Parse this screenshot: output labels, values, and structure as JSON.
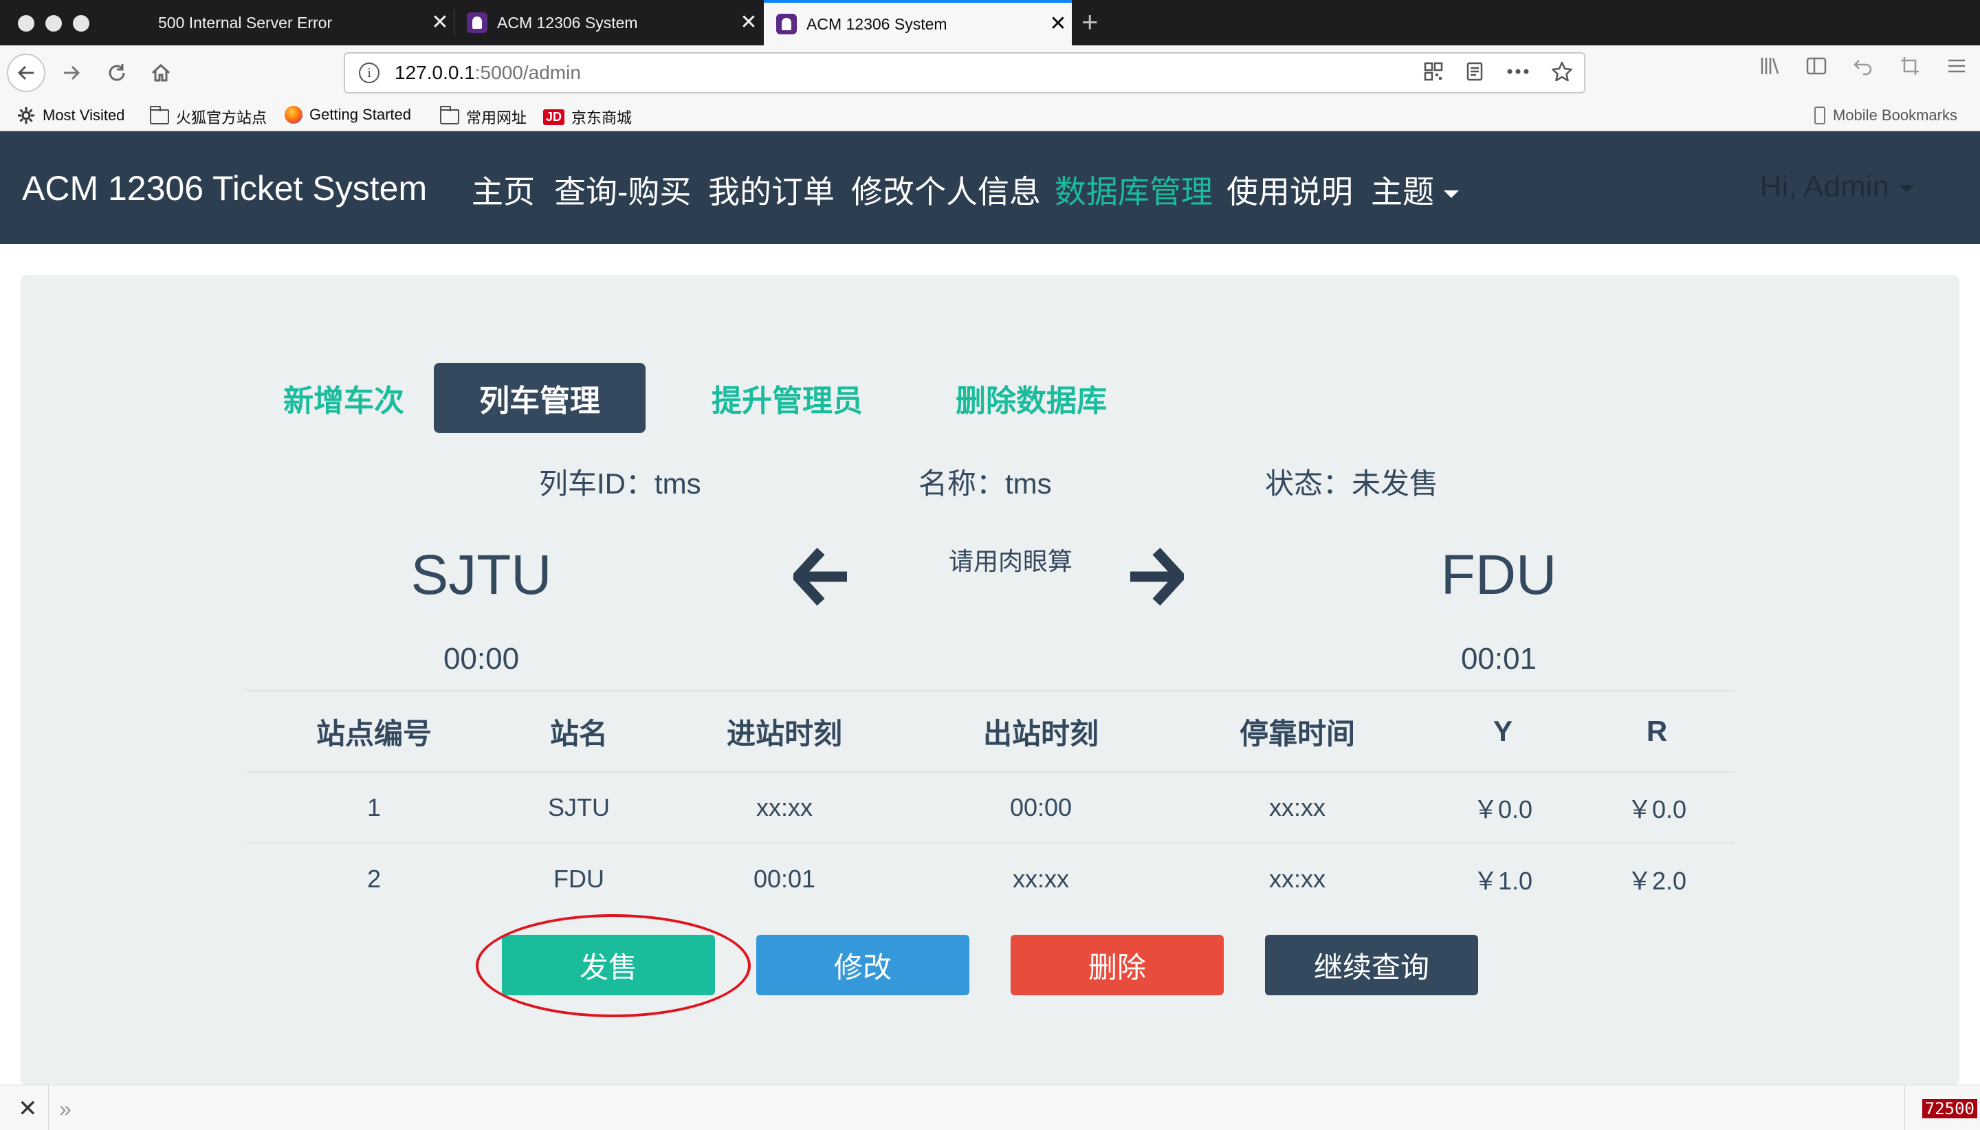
{
  "browser": {
    "tabs": [
      {
        "title": "500 Internal Server Error",
        "active": false
      },
      {
        "title": "ACM 12306 System",
        "active": false
      },
      {
        "title": "ACM 12306 System",
        "active": true
      }
    ],
    "url_host": "127.0.0.1",
    "url_path": ":5000/admin",
    "bookmarks": [
      "Most Visited",
      "火狐官方站点",
      "Getting Started",
      "常用网址",
      "京东商城"
    ],
    "mobile_bookmarks": "Mobile Bookmarks",
    "jd_logo": "JD",
    "status_badge": "72500"
  },
  "app": {
    "brand": "ACM 12306 Ticket System",
    "nav": [
      "主页",
      "查询-购买",
      "我的订单",
      "修改个人信息",
      "数据库管理",
      "使用说明",
      "主题"
    ],
    "active_nav": "数据库管理",
    "user_menu": "Hi, Admin"
  },
  "admin_tabs": [
    "新增车次",
    "列车管理",
    "提升管理员",
    "删除数据库"
  ],
  "active_admin_tab": "列车管理",
  "train": {
    "id_label": "列车ID：tms",
    "name_label": "名称：tms",
    "status_label": "状态：未发售",
    "from_station": "SJTU",
    "to_station": "FDU",
    "depart_time": "00:00",
    "arrive_time": "00:01",
    "duration_note": "请用肉眼算"
  },
  "table": {
    "headers": [
      "站点编号",
      "站名",
      "进站时刻",
      "出站时刻",
      "停靠时间",
      "Y",
      "R"
    ],
    "rows": [
      [
        "1",
        "SJTU",
        "xx:xx",
        "00:00",
        "xx:xx",
        "￥0.0",
        "￥0.0"
      ],
      [
        "2",
        "FDU",
        "00:01",
        "xx:xx",
        "xx:xx",
        "￥1.0",
        "￥2.0"
      ]
    ]
  },
  "buttons": {
    "sell": "发售",
    "edit": "修改",
    "delete": "删除",
    "continue": "继续查询"
  },
  "colors": {
    "navbar": "#2c3e50",
    "accent": "#1abc9c",
    "primary": "#3498db",
    "danger": "#e74c3c",
    "dark": "#34495e",
    "highlight_circle": "#e0141e"
  }
}
